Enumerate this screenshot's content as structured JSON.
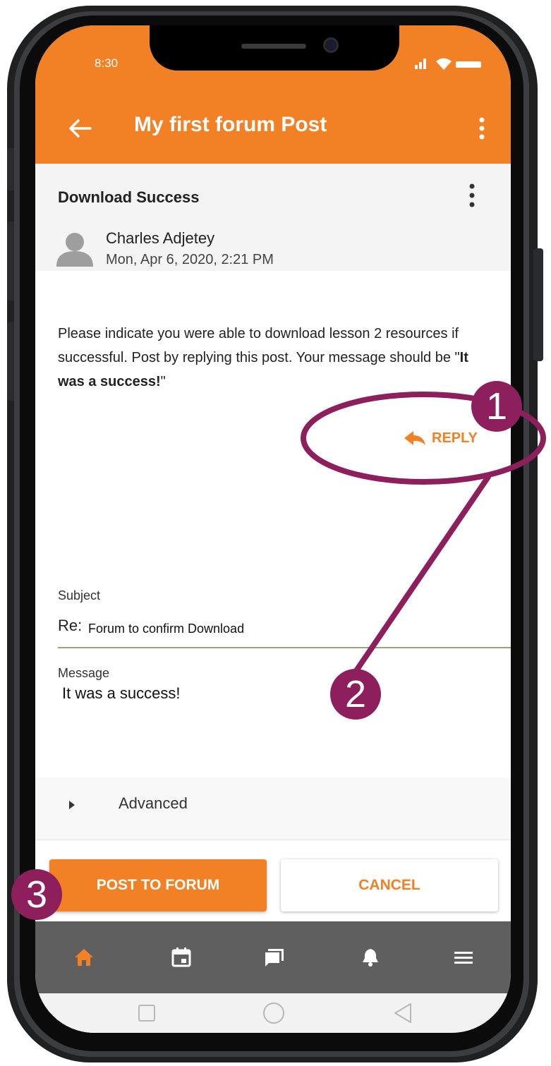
{
  "status_bar": {
    "time": "8:30"
  },
  "app_bar": {
    "title": "My first forum Post"
  },
  "post": {
    "title": "Download Success",
    "author": "Charles Adjetey",
    "date": "Mon, Apr 6, 2020, 2:21 PM",
    "body_text": "Please indicate you were able to download lesson 2 resources if successful. Post by replying this post. Your message should be \"",
    "body_bold": "It was a success!",
    "body_end": "\"",
    "reply_label": "REPLY"
  },
  "form": {
    "subject_label": "Subject",
    "subject_prefix": "Re:",
    "subject_value": "Forum to confirm Download",
    "message_label": "Message",
    "message_value": "It was a success!",
    "advanced_label": "Advanced"
  },
  "buttons": {
    "post": "POST TO FORUM",
    "cancel": "CANCEL"
  },
  "bottom_nav": {
    "items": [
      "home-icon",
      "calendar-icon",
      "forum-icon",
      "bell-icon",
      "menu-icon"
    ]
  },
  "annotations": {
    "badges": [
      "1",
      "2",
      "3"
    ]
  },
  "colors": {
    "accent": "#f28025",
    "annotation": "#8c1f5c",
    "nav_bar": "#5f5f5f"
  }
}
